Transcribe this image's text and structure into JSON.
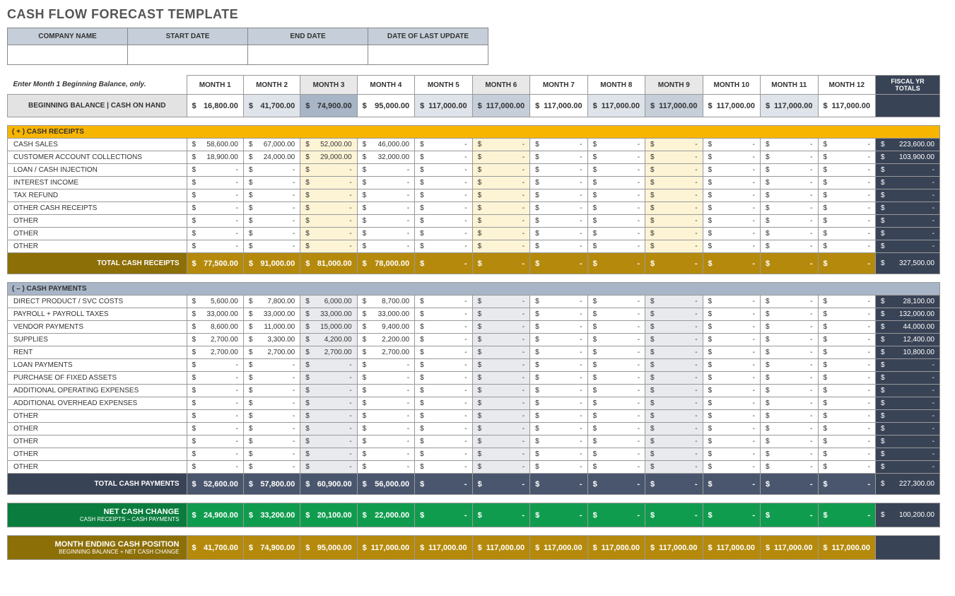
{
  "title": "CASH FLOW FORECAST TEMPLATE",
  "meta": {
    "h1": "COMPANY NAME",
    "h2": "START DATE",
    "h3": "END DATE",
    "h4": "DATE OF LAST UPDATE"
  },
  "instr": "Enter Month 1 Beginning Balance, only.",
  "months": [
    "MONTH 1",
    "MONTH 2",
    "MONTH 3",
    "MONTH 4",
    "MONTH 5",
    "MONTH 6",
    "MONTH 7",
    "MONTH 8",
    "MONTH 9",
    "MONTH 10",
    "MONTH 11",
    "MONTH 12"
  ],
  "fiscal": "FISCAL YR TOTALS",
  "bbLabel": "BEGINNING BALANCE  |  CASH ON HAND",
  "bb": [
    "16,800.00",
    "41,700.00",
    "74,900.00",
    "95,000.00",
    "117,000.00",
    "117,000.00",
    "117,000.00",
    "117,000.00",
    "117,000.00",
    "117,000.00",
    "117,000.00",
    "117,000.00"
  ],
  "recHdr": "( + )   CASH RECEIPTS",
  "receipts": [
    {
      "label": "CASH SALES",
      "v": [
        "58,600.00",
        "67,000.00",
        "52,000.00",
        "46,000.00",
        "-",
        "-",
        "-",
        "-",
        "-",
        "-",
        "-",
        "-"
      ],
      "t": "223,600.00"
    },
    {
      "label": "CUSTOMER ACCOUNT COLLECTIONS",
      "v": [
        "18,900.00",
        "24,000.00",
        "29,000.00",
        "32,000.00",
        "-",
        "-",
        "-",
        "-",
        "-",
        "-",
        "-",
        "-"
      ],
      "t": "103,900.00"
    },
    {
      "label": "LOAN / CASH INJECTION",
      "v": [
        "-",
        "-",
        "-",
        "-",
        "-",
        "-",
        "-",
        "-",
        "-",
        "-",
        "-",
        "-"
      ],
      "t": "-"
    },
    {
      "label": "INTEREST INCOME",
      "v": [
        "-",
        "-",
        "-",
        "-",
        "-",
        "-",
        "-",
        "-",
        "-",
        "-",
        "-",
        "-"
      ],
      "t": "-"
    },
    {
      "label": "TAX REFUND",
      "v": [
        "-",
        "-",
        "-",
        "-",
        "-",
        "-",
        "-",
        "-",
        "-",
        "-",
        "-",
        "-"
      ],
      "t": "-"
    },
    {
      "label": "OTHER CASH RECEIPTS",
      "v": [
        "-",
        "-",
        "-",
        "-",
        "-",
        "-",
        "-",
        "-",
        "-",
        "-",
        "-",
        "-"
      ],
      "t": "-"
    },
    {
      "label": "OTHER",
      "v": [
        "-",
        "-",
        "-",
        "-",
        "-",
        "-",
        "-",
        "-",
        "-",
        "-",
        "-",
        "-"
      ],
      "t": "-"
    },
    {
      "label": "OTHER",
      "v": [
        "-",
        "-",
        "-",
        "-",
        "-",
        "-",
        "-",
        "-",
        "-",
        "-",
        "-",
        "-"
      ],
      "t": "-"
    },
    {
      "label": "OTHER",
      "v": [
        "-",
        "-",
        "-",
        "-",
        "-",
        "-",
        "-",
        "-",
        "-",
        "-",
        "-",
        "-"
      ],
      "t": "-"
    }
  ],
  "recTotLabel": "TOTAL CASH RECEIPTS",
  "recTot": [
    "77,500.00",
    "91,000.00",
    "81,000.00",
    "78,000.00",
    "-",
    "-",
    "-",
    "-",
    "-",
    "-",
    "-",
    "-"
  ],
  "recTotT": "327,500.00",
  "payHdr": "( – )   CASH PAYMENTS",
  "payments": [
    {
      "label": "DIRECT PRODUCT / SVC COSTS",
      "v": [
        "5,600.00",
        "7,800.00",
        "6,000.00",
        "8,700.00",
        "-",
        "-",
        "-",
        "-",
        "-",
        "-",
        "-",
        "-"
      ],
      "t": "28,100.00"
    },
    {
      "label": "PAYROLL + PAYROLL TAXES",
      "v": [
        "33,000.00",
        "33,000.00",
        "33,000.00",
        "33,000.00",
        "-",
        "-",
        "-",
        "-",
        "-",
        "-",
        "-",
        "-"
      ],
      "t": "132,000.00"
    },
    {
      "label": "VENDOR PAYMENTS",
      "v": [
        "8,600.00",
        "11,000.00",
        "15,000.00",
        "9,400.00",
        "-",
        "-",
        "-",
        "-",
        "-",
        "-",
        "-",
        "-"
      ],
      "t": "44,000.00"
    },
    {
      "label": "SUPPLIES",
      "v": [
        "2,700.00",
        "3,300.00",
        "4,200.00",
        "2,200.00",
        "-",
        "-",
        "-",
        "-",
        "-",
        "-",
        "-",
        "-"
      ],
      "t": "12,400.00"
    },
    {
      "label": "RENT",
      "v": [
        "2,700.00",
        "2,700.00",
        "2,700.00",
        "2,700.00",
        "-",
        "-",
        "-",
        "-",
        "-",
        "-",
        "-",
        "-"
      ],
      "t": "10,800.00"
    },
    {
      "label": "LOAN PAYMENTS",
      "v": [
        "-",
        "-",
        "-",
        "-",
        "-",
        "-",
        "-",
        "-",
        "-",
        "-",
        "-",
        "-"
      ],
      "t": "-"
    },
    {
      "label": "PURCHASE OF FIXED ASSETS",
      "v": [
        "-",
        "-",
        "-",
        "-",
        "-",
        "-",
        "-",
        "-",
        "-",
        "-",
        "-",
        "-"
      ],
      "t": "-"
    },
    {
      "label": "ADDITIONAL OPERATING EXPENSES",
      "v": [
        "-",
        "-",
        "-",
        "-",
        "-",
        "-",
        "-",
        "-",
        "-",
        "-",
        "-",
        "-"
      ],
      "t": "-"
    },
    {
      "label": "ADDITIONAL OVERHEAD EXPENSES",
      "v": [
        "-",
        "-",
        "-",
        "-",
        "-",
        "-",
        "-",
        "-",
        "-",
        "-",
        "-",
        "-"
      ],
      "t": "-"
    },
    {
      "label": "OTHER",
      "v": [
        "-",
        "-",
        "-",
        "-",
        "-",
        "-",
        "-",
        "-",
        "-",
        "-",
        "-",
        "-"
      ],
      "t": "-"
    },
    {
      "label": "OTHER",
      "v": [
        "-",
        "-",
        "-",
        "-",
        "-",
        "-",
        "-",
        "-",
        "-",
        "-",
        "-",
        "-"
      ],
      "t": "-"
    },
    {
      "label": "OTHER",
      "v": [
        "-",
        "-",
        "-",
        "-",
        "-",
        "-",
        "-",
        "-",
        "-",
        "-",
        "-",
        "-"
      ],
      "t": "-"
    },
    {
      "label": "OTHER",
      "v": [
        "-",
        "-",
        "-",
        "-",
        "-",
        "-",
        "-",
        "-",
        "-",
        "-",
        "-",
        "-"
      ],
      "t": "-"
    },
    {
      "label": "OTHER",
      "v": [
        "-",
        "-",
        "-",
        "-",
        "-",
        "-",
        "-",
        "-",
        "-",
        "-",
        "-",
        "-"
      ],
      "t": "-"
    }
  ],
  "payTotLabel": "TOTAL CASH PAYMENTS",
  "payTot": [
    "52,600.00",
    "57,800.00",
    "60,900.00",
    "56,000.00",
    "-",
    "-",
    "-",
    "-",
    "-",
    "-",
    "-",
    "-"
  ],
  "payTotT": "227,300.00",
  "netLabel": "NET CASH CHANGE",
  "netSub": "CASH RECEIPTS – CASH PAYMENTS",
  "net": [
    "24,900.00",
    "33,200.00",
    "20,100.00",
    "22,000.00",
    "-",
    "-",
    "-",
    "-",
    "-",
    "-",
    "-",
    "-"
  ],
  "netT": "100,200.00",
  "endLabel": "MONTH ENDING CASH POSITION",
  "endSub": "BEGINNING BALANCE + NET CASH CHANGE",
  "end": [
    "41,700.00",
    "74,900.00",
    "95,000.00",
    "117,000.00",
    "117,000.00",
    "117,000.00",
    "117,000.00",
    "117,000.00",
    "117,000.00",
    "117,000.00",
    "117,000.00",
    "117,000.00"
  ]
}
